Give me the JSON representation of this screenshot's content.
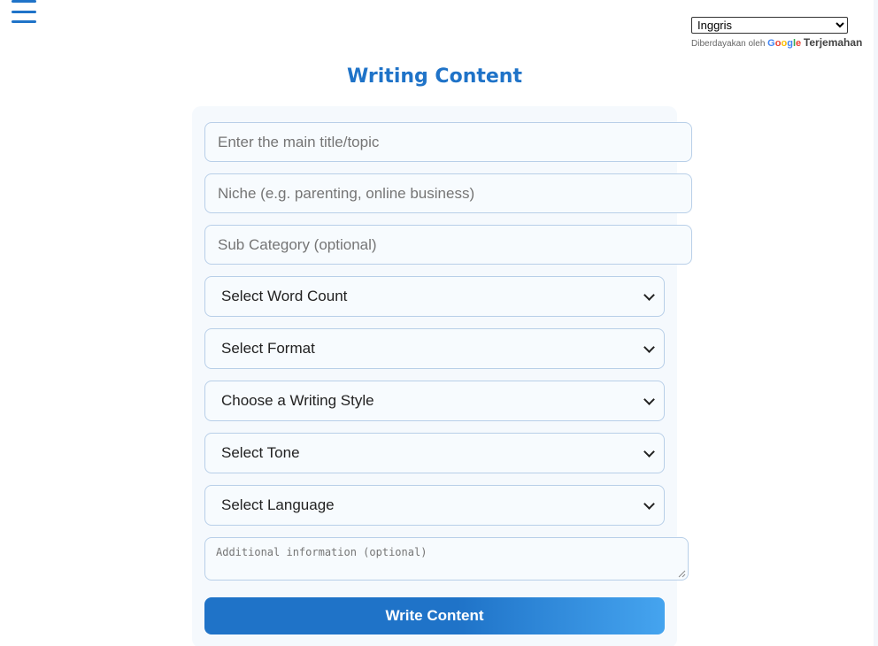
{
  "header": {
    "menu_icon": "hamburger-menu-icon",
    "title": "Writing Content"
  },
  "translate": {
    "selected_language": "Inggris",
    "powered_by": "Diberdayakan oleh",
    "google_letters": [
      "G",
      "o",
      "o",
      "g",
      "l",
      "e"
    ],
    "translate_label": "Terjemahan"
  },
  "form": {
    "title_placeholder": "Enter the main title/topic",
    "niche_placeholder": "Niche (e.g. parenting, online business)",
    "subcategory_placeholder": "Sub Category (optional)",
    "word_count_selected": "Select Word Count",
    "format_selected": "Select Format",
    "writing_style_selected": "Choose a Writing Style",
    "tone_selected": "Select Tone",
    "language_selected": "Select Language",
    "additional_info_placeholder": "Additional information (optional)",
    "submit_label": "Write Content"
  },
  "colors": {
    "accent": "#1f73c8",
    "accent_light": "#45a4ef",
    "card_bg": "#f5f9fd",
    "field_border": "#b8cfe8"
  }
}
